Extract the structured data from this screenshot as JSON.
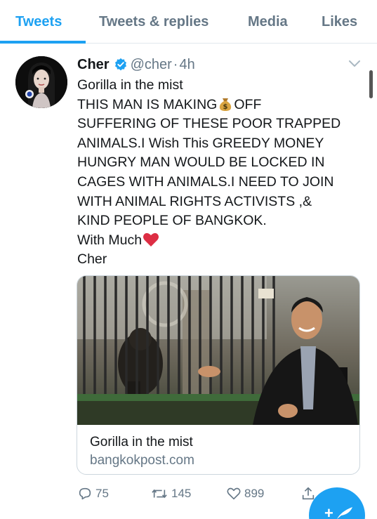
{
  "tabs": [
    {
      "label": "Tweets",
      "active": true
    },
    {
      "label": "Tweets & replies",
      "active": false
    },
    {
      "label": "Media",
      "active": false
    },
    {
      "label": "Likes",
      "active": false
    }
  ],
  "tweet": {
    "author_name": "Cher",
    "handle": "@cher",
    "separator": "·",
    "time": "4h",
    "lines": [
      "Gorilla in the mist",
      "THIS MAN IS MAKING",
      "OFF",
      "SUFFERING OF THESE POOR TRAPPED",
      "ANIMALS.I Wish This GREEDY MONEY",
      "HUNGRY MAN WOULD BE LOCKED IN",
      "CAGES WITH ANIMALS.I NEED TO JOIN",
      "WITH ANIMAL RIGHTS ACTIVISTS ,&",
      "KIND PEOPLE OF BANGKOK.",
      "With Much",
      "Cher"
    ],
    "icons": [
      "verified-badge-icon",
      "money-bag-emoji",
      "red-heart-emoji",
      "chevron-down-icon"
    ]
  },
  "card": {
    "title": "Gorilla in the mist",
    "domain": "bangkokpost.com"
  },
  "actions": {
    "replies": "75",
    "retweets": "145",
    "likes": "899"
  },
  "fab": {
    "label": "+"
  },
  "colors": {
    "accent": "#1da1f2",
    "secondary_text": "#657786",
    "heart_emoji": "#dd2e44",
    "border": "#e1e8ed"
  }
}
